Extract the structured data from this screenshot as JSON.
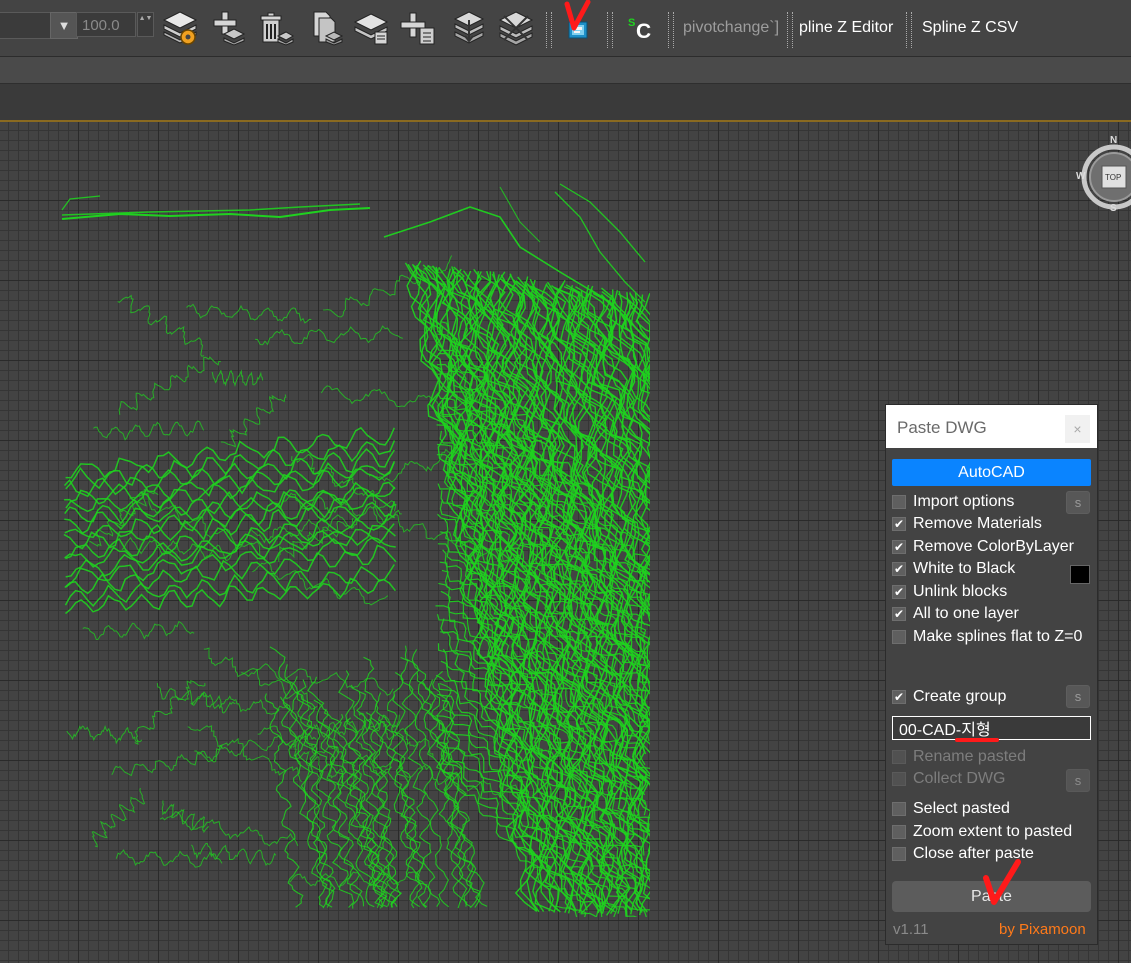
{
  "toolbar": {
    "dropdown_arrow": "▼",
    "spinner_value": "100.0",
    "spinner_arrows": "▲▼",
    "icons": [
      "layer-settings-icon",
      "layer-add-icon",
      "layer-delete-icon",
      "layer-copy-icon",
      "layer-stack-icon",
      "add-to-layer-icon",
      "layer-merge-icon",
      "layer-hide-icon",
      "paste-dwg-icon",
      "script-sc-icon"
    ],
    "sc_label": "C",
    "scripts": [
      "pivotchange`]",
      "pline Z Editor",
      "Spline Z CSV"
    ]
  },
  "viewcube": {
    "north": "N",
    "south": "S",
    "west": "W",
    "face": "TOP"
  },
  "panel": {
    "title": "Paste DWG",
    "close_glyph": "×",
    "autocad_button": "AutoCAD",
    "check_glyph": "✔",
    "options": [
      {
        "label": "Import options",
        "checked": false,
        "enabled": true
      },
      {
        "label": "Remove Materials",
        "checked": true,
        "enabled": true
      },
      {
        "label": "Remove ColorByLayer",
        "checked": true,
        "enabled": true
      },
      {
        "label": "White to Black",
        "checked": true,
        "enabled": true
      },
      {
        "label": "Unlink blocks",
        "checked": true,
        "enabled": true
      },
      {
        "label": "All to one layer",
        "checked": true,
        "enabled": true
      },
      {
        "label": "Make splines flat to Z=0",
        "checked": false,
        "enabled": true
      },
      {
        "label": "Create group",
        "checked": true,
        "enabled": true
      },
      {
        "label": "Rename pasted",
        "checked": false,
        "enabled": false
      },
      {
        "label": "Collect DWG",
        "checked": false,
        "enabled": false
      },
      {
        "label": "Select pasted",
        "checked": false,
        "enabled": true
      },
      {
        "label": "Zoom extent to pasted",
        "checked": false,
        "enabled": true
      },
      {
        "label": "Close after paste",
        "checked": false,
        "enabled": true
      }
    ],
    "settings_button": "s",
    "group_name": "00-CAD-지형",
    "paste_button": "Paste",
    "version": "v1.11",
    "author": "by Pixamoon"
  },
  "colors": {
    "accent": "#0a84ff",
    "contour": "#1fd21f",
    "author": "#ff7a1a",
    "annotation": "#ff1a1a"
  }
}
